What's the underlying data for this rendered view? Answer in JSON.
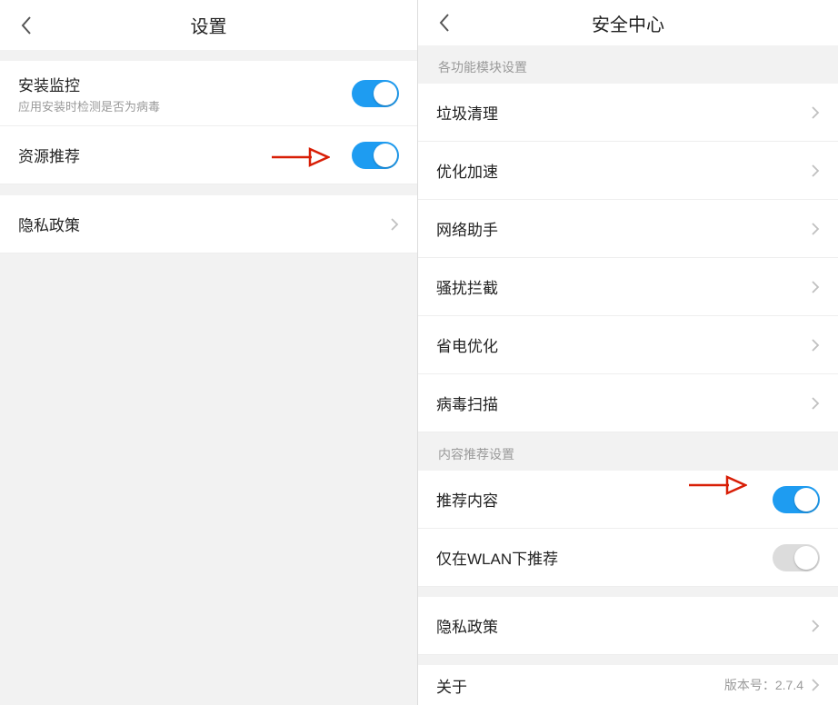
{
  "left": {
    "title": "设置",
    "rows": {
      "install": {
        "label": "安装监控",
        "sub": "应用安装时检测是否为病毒"
      },
      "resource_rec": {
        "label": "资源推荐"
      },
      "privacy": {
        "label": "隐私政策"
      }
    }
  },
  "right": {
    "title": "安全中心",
    "section1": "各功能模块设置",
    "modules": {
      "junk": "垃圾清理",
      "boost": "优化加速",
      "network": "网络助手",
      "block": "骚扰拦截",
      "power": "省电优化",
      "virus": "病毒扫描"
    },
    "section2": "内容推荐设置",
    "rec_content": "推荐内容",
    "rec_wlan": "仅在WLAN下推荐",
    "privacy": "隐私政策",
    "about": "关于",
    "version_prefix": "版本号：",
    "version": "2.7.4"
  }
}
